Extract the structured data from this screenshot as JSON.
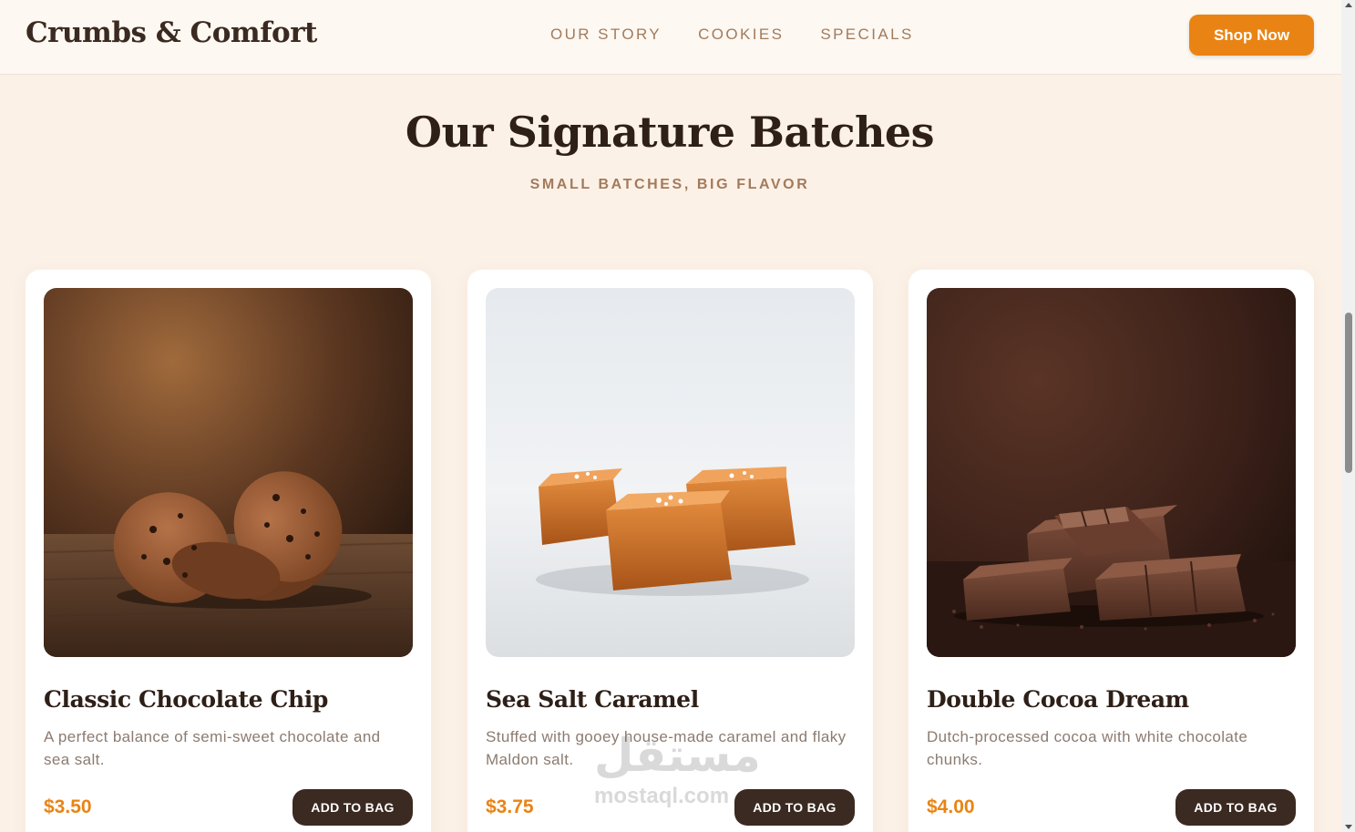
{
  "header": {
    "logo": "Crumbs & Comfort",
    "nav": [
      "OUR STORY",
      "COOKIES",
      "SPECIALS"
    ],
    "cta": "Shop Now"
  },
  "section": {
    "title": "Our Signature Batches",
    "subtitle": "SMALL BATCHES, BIG FLAVOR"
  },
  "products": [
    {
      "name": "Classic Chocolate Chip",
      "description": "A perfect balance of semi-sweet chocolate and sea salt.",
      "price": "$3.50",
      "button": "ADD TO BAG",
      "image": "chocolate-chip-cookies-photo"
    },
    {
      "name": "Sea Salt Caramel",
      "description": "Stuffed with gooey house-made caramel and flaky Maldon salt.",
      "price": "$3.75",
      "button": "ADD TO BAG",
      "image": "sea-salt-caramels-photo"
    },
    {
      "name": "Double Cocoa Dream",
      "description": "Dutch-processed cocoa with white chocolate chunks.",
      "price": "$4.00",
      "button": "ADD TO BAG",
      "image": "chocolate-bar-pieces-photo"
    }
  ],
  "watermark": {
    "arabic": "مستقل",
    "latin": "mostaql.com"
  },
  "colors": {
    "accent": "#e98414",
    "dark": "#3b2a21",
    "muted": "#a27b5c",
    "background": "#fcf1e7"
  }
}
